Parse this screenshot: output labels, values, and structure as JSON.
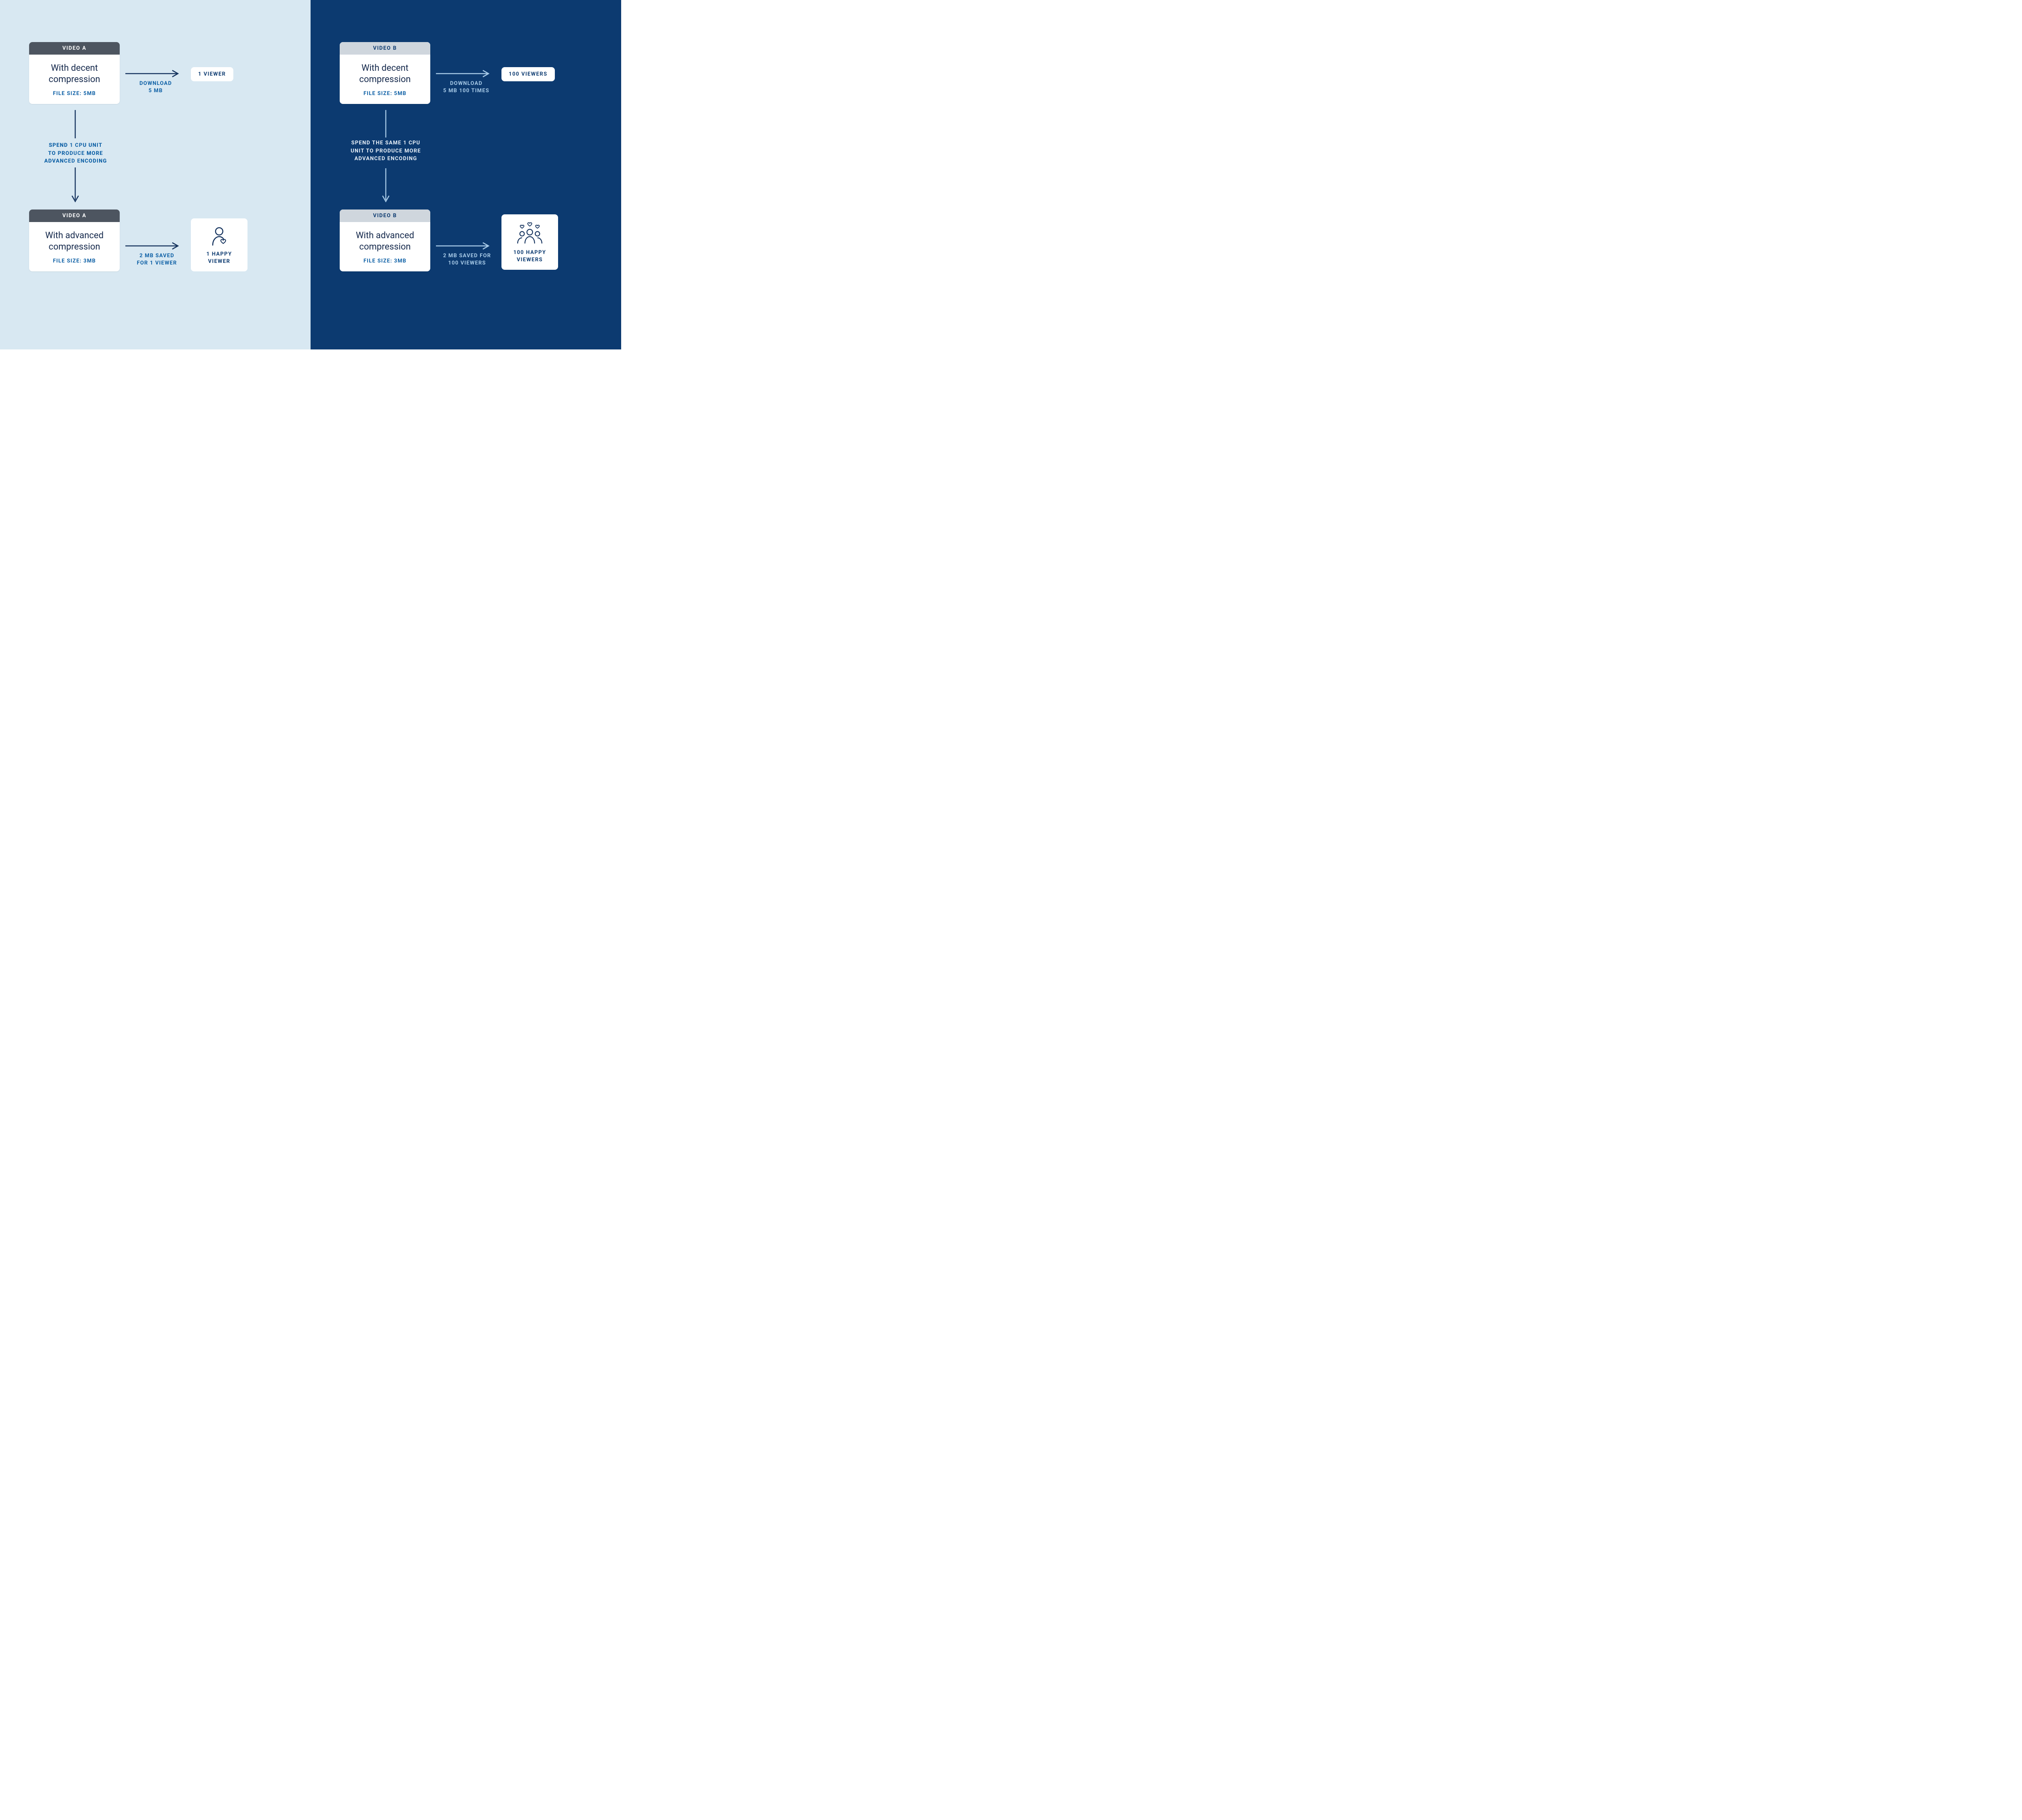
{
  "left": {
    "top_card": {
      "header": "VIDEO A",
      "title": "With decent compression",
      "size": "FILE SIZE: 5MB"
    },
    "bottom_card": {
      "header": "VIDEO A",
      "title": "With advanced compression",
      "size": "FILE SIZE: 3MB"
    },
    "top_arrow_label": "DOWNLOAD\n5 MB",
    "top_pill": "1 VIEWER",
    "vertical_label": "SPEND 1 CPU UNIT\nTO PRODUCE MORE\nADVANCED ENCODING",
    "bottom_arrow_label": "2 MB SAVED\nFOR 1 VIEWER",
    "bottom_pill": "1 HAPPY\nVIEWER"
  },
  "right": {
    "top_card": {
      "header": "VIDEO B",
      "title": "With decent compression",
      "size": "FILE SIZE: 5MB"
    },
    "bottom_card": {
      "header": "VIDEO B",
      "title": "With advanced compression",
      "size": "FILE SIZE: 3MB"
    },
    "top_arrow_label": "DOWNLOAD\n5 MB 100 TIMES",
    "top_pill": "100 VIEWERS",
    "vertical_label": "SPEND THE SAME 1 CPU\nUNIT TO PRODUCE MORE\nADVANCED ENCODING",
    "bottom_arrow_label": "2 MB SAVED FOR\n100 VIEWERS",
    "bottom_pill": "100 HAPPY\nVIEWERS"
  }
}
